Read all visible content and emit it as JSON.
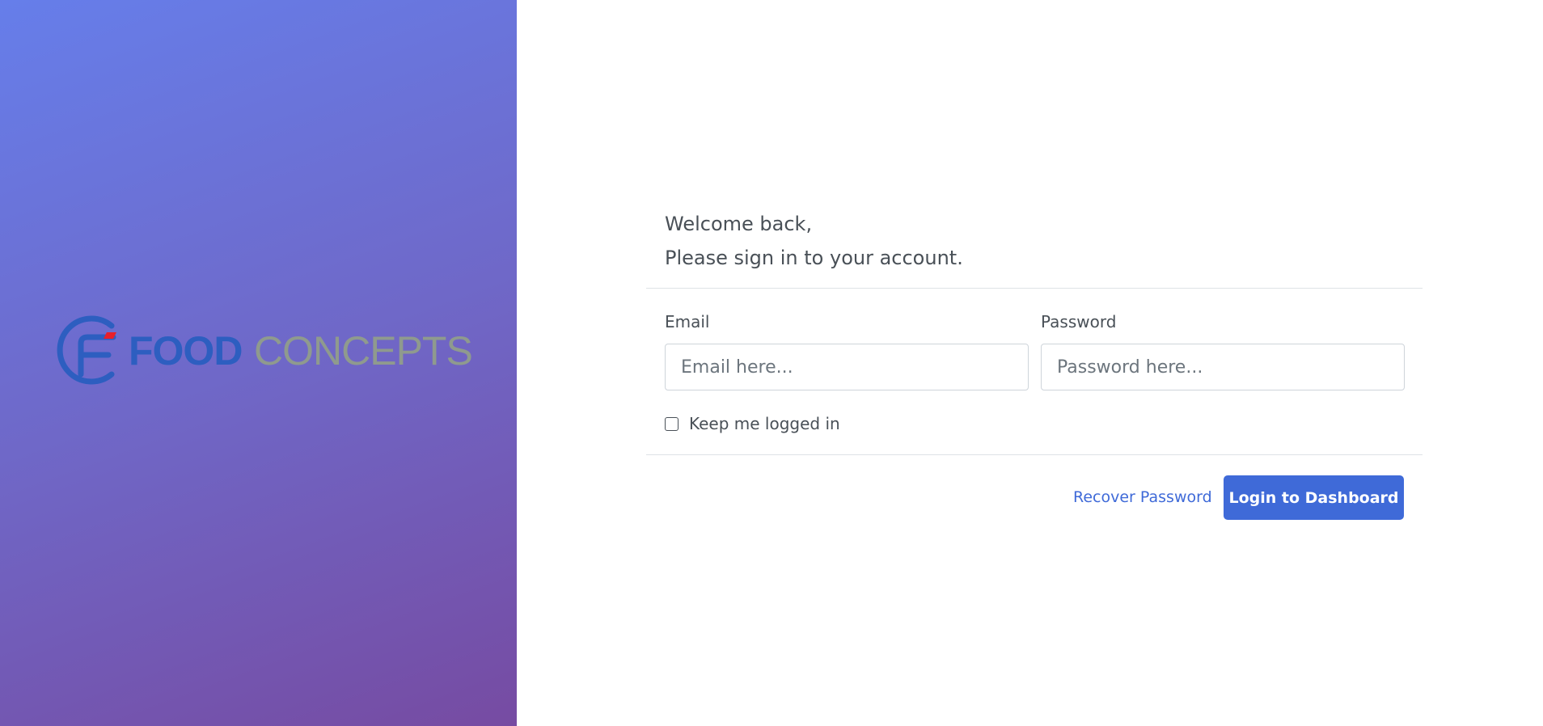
{
  "branding": {
    "logo_word_primary": "FOOD",
    "logo_word_secondary": "CONCEPTS",
    "logo_primary_color": "#2d5ec0",
    "logo_secondary_color": "#8f9a8e",
    "logo_accent_color": "#e8202a",
    "panel_gradient_start": "#667eea",
    "panel_gradient_end": "#764ba2"
  },
  "header": {
    "greeting": "Welcome back,",
    "subtitle": "Please sign in to your account."
  },
  "form": {
    "email_label": "Email",
    "email_placeholder": "Email here...",
    "email_value": "",
    "password_label": "Password",
    "password_placeholder": "Password here...",
    "password_value": "",
    "remember_label": "Keep me logged in",
    "remember_checked": false
  },
  "actions": {
    "recover_label": "Recover Password",
    "login_label": "Login to Dashboard",
    "accent_color": "#3f6ad8"
  }
}
